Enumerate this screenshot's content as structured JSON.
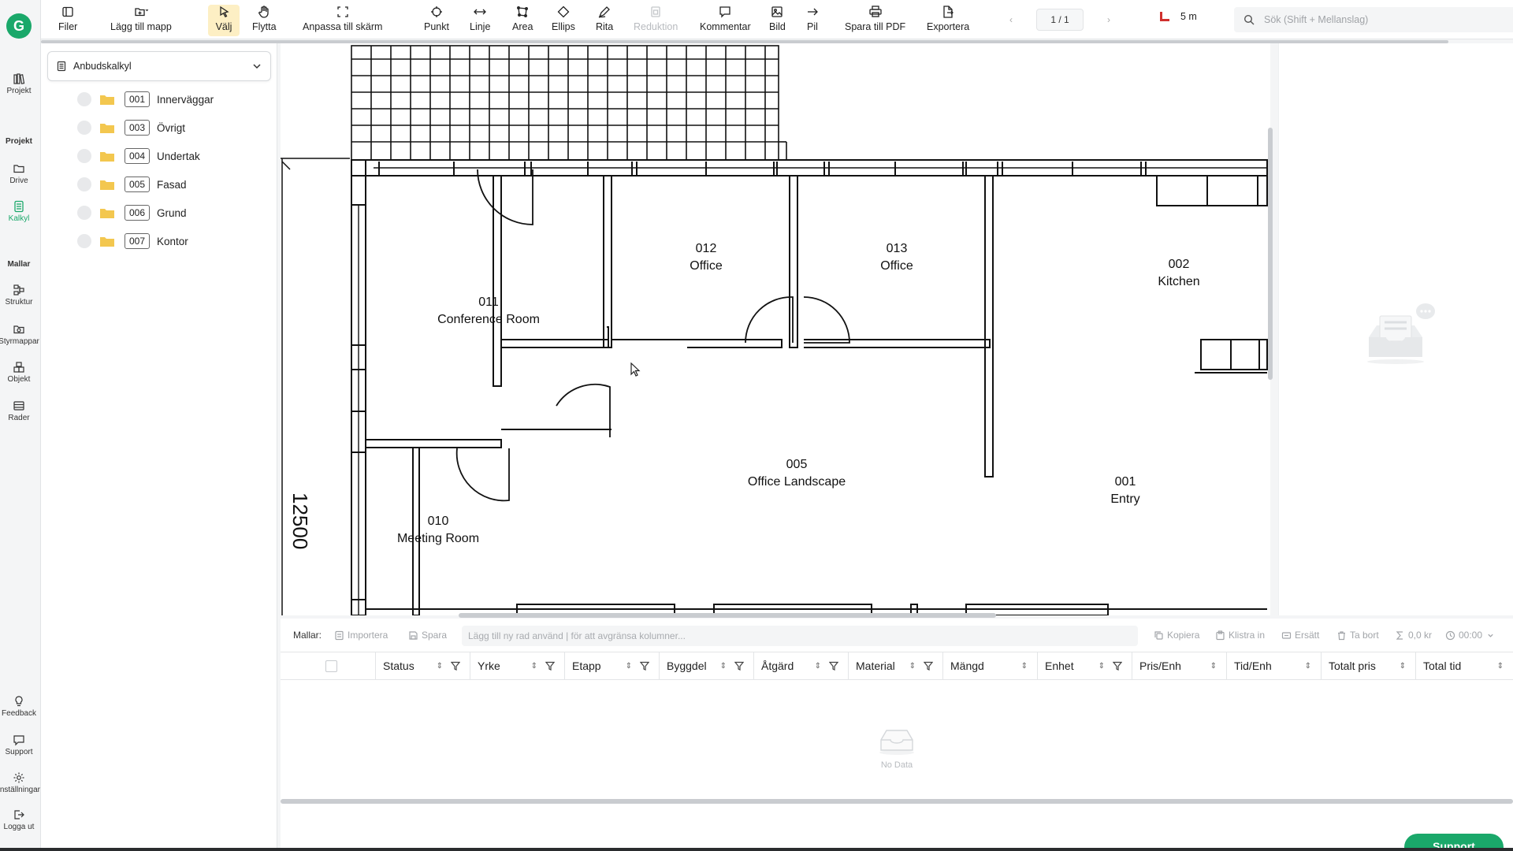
{
  "app": {
    "logo_letter": "G"
  },
  "rail": {
    "projekt": "Projekt",
    "section_projekt": "Projekt",
    "drive": "Drive",
    "kalkyl": "Kalkyl",
    "section_mallar": "Mallar",
    "struktur": "Struktur",
    "styrmappar": "Styrmappar",
    "objekt": "Objekt",
    "rader": "Rader",
    "feedback": "Feedback",
    "support": "Support",
    "installningar": "Inställningar",
    "logga_ut": "Logga ut"
  },
  "toolbar": {
    "filer": "Filer",
    "lagg_till_mapp": "Lägg till mapp",
    "valj": "Välj",
    "flytta": "Flytta",
    "anpassa": "Anpassa till skärm",
    "punkt": "Punkt",
    "linje": "Linje",
    "area": "Area",
    "ellips": "Ellips",
    "rita": "Rita",
    "reduktion": "Reduktion",
    "kommentar": "Kommentar",
    "bild": "Bild",
    "pil": "Pil",
    "spara_pdf": "Spara till PDF",
    "exportera": "Exportera",
    "page": "1 / 1",
    "scale": "5 m",
    "search_placeholder": "Sök (Shift + Mellanslag)"
  },
  "panel": {
    "selected": "Anbudskalkyl",
    "items": [
      {
        "code": "001",
        "label": "Innerväggar"
      },
      {
        "code": "003",
        "label": "Övrigt"
      },
      {
        "code": "004",
        "label": "Undertak"
      },
      {
        "code": "005",
        "label": "Fasad"
      },
      {
        "code": "006",
        "label": "Grund"
      },
      {
        "code": "007",
        "label": "Kontor"
      }
    ]
  },
  "drawing": {
    "dimension": "12500",
    "rooms": [
      {
        "num": "011",
        "name": "Conference Room"
      },
      {
        "num": "012",
        "name": "Office"
      },
      {
        "num": "013",
        "name": "Office"
      },
      {
        "num": "002",
        "name": "Kitchen"
      },
      {
        "num": "005",
        "name": "Office Landscape"
      },
      {
        "num": "001",
        "name": "Entry"
      },
      {
        "num": "010",
        "name": "Meeting Room"
      }
    ]
  },
  "table": {
    "mallar_label": "Mallar:",
    "importera": "Importera",
    "spara": "Spara",
    "row_placeholder": "Lägg till ny rad använd | för att avgränsa kolumner...",
    "kopiera": "Kopiera",
    "klistra_in": "Klistra in",
    "ersatt": "Ersätt",
    "ta_bort": "Ta bort",
    "sum": "0,0 kr",
    "time": "00:00",
    "columns": [
      "Status",
      "Yrke",
      "Etapp",
      "Byggdel",
      "Åtgärd",
      "Material",
      "Mängd",
      "Enhet",
      "Pris/Enh",
      "Tid/Enh",
      "Totalt pris",
      "Total tid"
    ],
    "empty_text": "No Data"
  },
  "support_button": "Support"
}
